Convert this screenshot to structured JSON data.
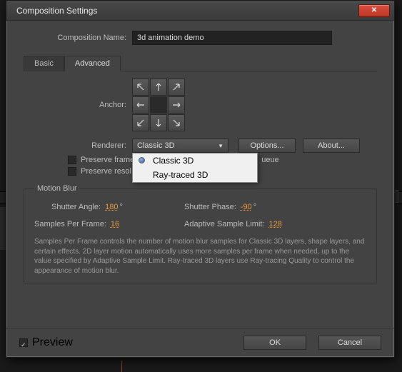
{
  "window": {
    "title": "Composition Settings"
  },
  "comp_name": {
    "label": "Composition Name:",
    "value": "3d animation demo"
  },
  "tabs": {
    "basic": "Basic",
    "advanced": "Advanced",
    "active": "advanced"
  },
  "anchor": {
    "label": "Anchor:"
  },
  "renderer": {
    "label": "Renderer:",
    "value": "Classic 3D",
    "options": [
      "Classic 3D",
      "Ray-traced 3D"
    ],
    "options_btn": "Options...",
    "about_btn": "About..."
  },
  "checks": {
    "preserve_frame": {
      "label": "Preserve frame",
      "tail": "ueue",
      "checked": false
    },
    "preserve_res": {
      "label": "Preserve resol",
      "checked": false
    }
  },
  "motion_blur": {
    "legend": "Motion Blur",
    "shutter_angle": {
      "label": "Shutter Angle:",
      "value": "180",
      "unit": "°"
    },
    "shutter_phase": {
      "label": "Shutter Phase:",
      "value": "-90",
      "unit": "°"
    },
    "samples_per_frame": {
      "label": "Samples Per Frame:",
      "value": "16"
    },
    "adaptive_limit": {
      "label": "Adaptive Sample Limit:",
      "value": "128"
    },
    "help": "Samples Per Frame controls the number of motion blur samples for Classic 3D layers, shape layers, and certain effects. 2D layer motion automatically uses more samples per frame when needed, up to the value specified by Adaptive Sample Limit. Ray-traced 3D layers use Ray-tracing Quality to control the appearance of motion blur."
  },
  "footer": {
    "preview": "Preview",
    "preview_checked": true,
    "ok": "OK",
    "cancel": "Cancel"
  }
}
